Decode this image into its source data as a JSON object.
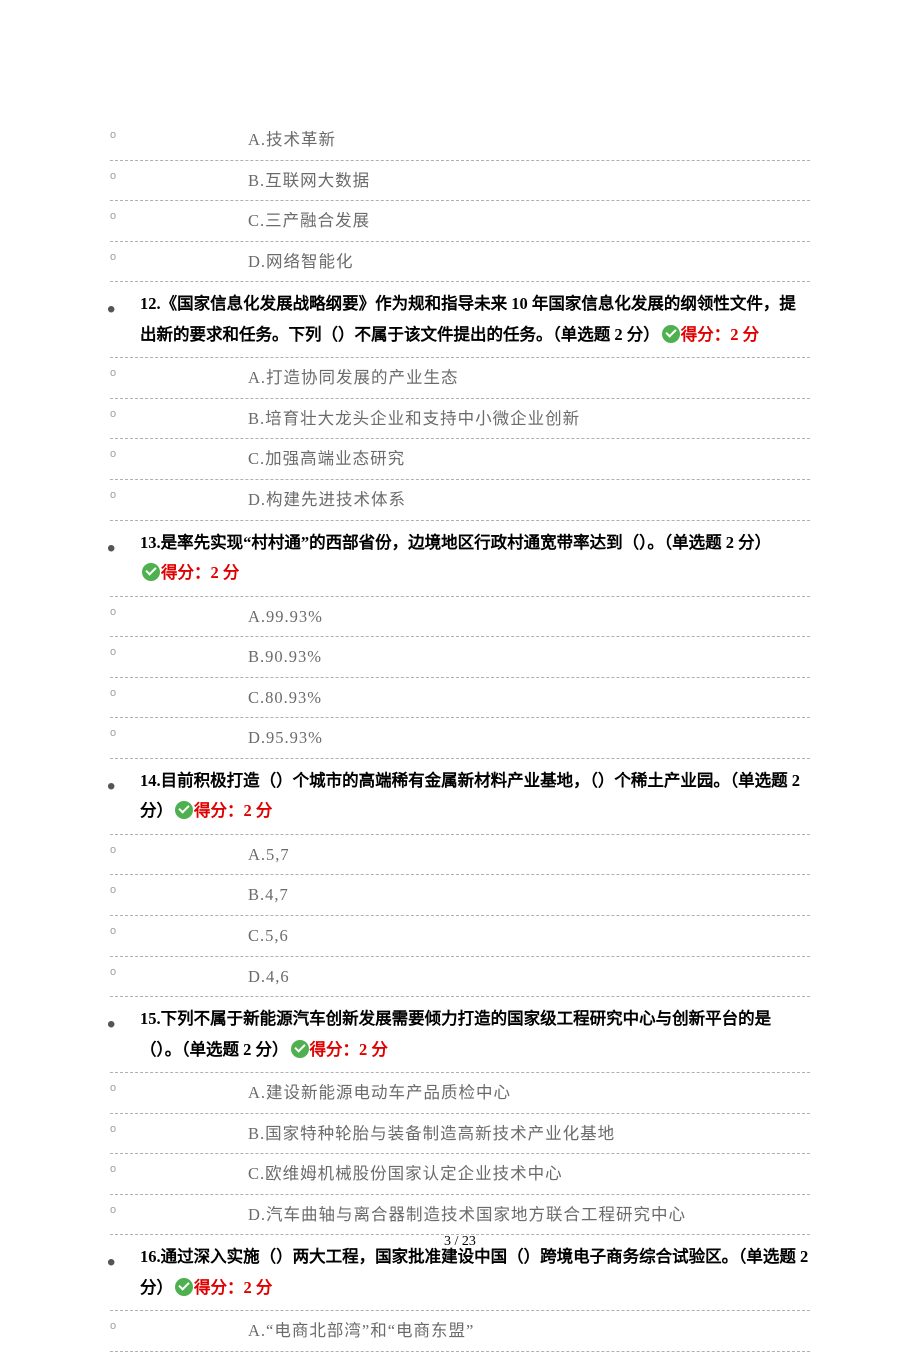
{
  "q11_options": {
    "a": "A.技术革新",
    "b": "B.互联网大数据",
    "c": "C.三产融合发展",
    "d": "D.网络智能化"
  },
  "q12": {
    "num": "12.",
    "stem": "《国家信息化发展战略纲要》作为规和指导未来 10 年国家信息化发展的纲领性文件，提出新的要求和任务。下列（）不属于该文件提出的任务。",
    "tag": "（单选题 2 分）",
    "score": "得分：2 分",
    "options": {
      "a": "A.打造协同发展的产业生态",
      "b": "B.培育壮大龙头企业和支持中小微企业创新",
      "c": "C.加强高端业态研究",
      "d": "D.构建先进技术体系"
    }
  },
  "q13": {
    "num": "13.",
    "stem": "是率先实现“村村通”的西部省份，边境地区行政村通宽带率达到（）。",
    "tag": "（单选题 2 分）",
    "score": "得分：2 分",
    "options": {
      "a": "A.99.93%",
      "b": "B.90.93%",
      "c": "C.80.93%",
      "d": "D.95.93%"
    }
  },
  "q14": {
    "num": "14.",
    "stem": "目前积极打造（）个城市的高端稀有金属新材料产业基地，（）个稀土产业园。",
    "tag": "（单选题 2 分）",
    "score": "得分：2 分",
    "options": {
      "a": "A.5,7",
      "b": "B.4,7",
      "c": "C.5,6",
      "d": "D.4,6"
    }
  },
  "q15": {
    "num": "15.",
    "stem": "下列不属于新能源汽车创新发展需要倾力打造的国家级工程研究中心与创新平台的是（）。",
    "tag": "（单选题 2 分）",
    "score": "得分：2 分",
    "options": {
      "a": "A.建设新能源电动车产品质检中心",
      "b": "B.国家特种轮胎与装备制造高新技术产业化基地",
      "c": "C.欧维姆机械股份国家认定企业技术中心",
      "d": "D.汽车曲轴与离合器制造技术国家地方联合工程研究中心"
    }
  },
  "q16": {
    "num": "16.",
    "stem": "通过深入实施（）两大工程，国家批准建设中国（）跨境电子商务综合试验区。",
    "tag": "（单选题 2 分）",
    "score": "得分：2 分",
    "options": {
      "a": "A.“电商北部湾”和“电商东盟”"
    }
  },
  "footer": "3  / 23"
}
